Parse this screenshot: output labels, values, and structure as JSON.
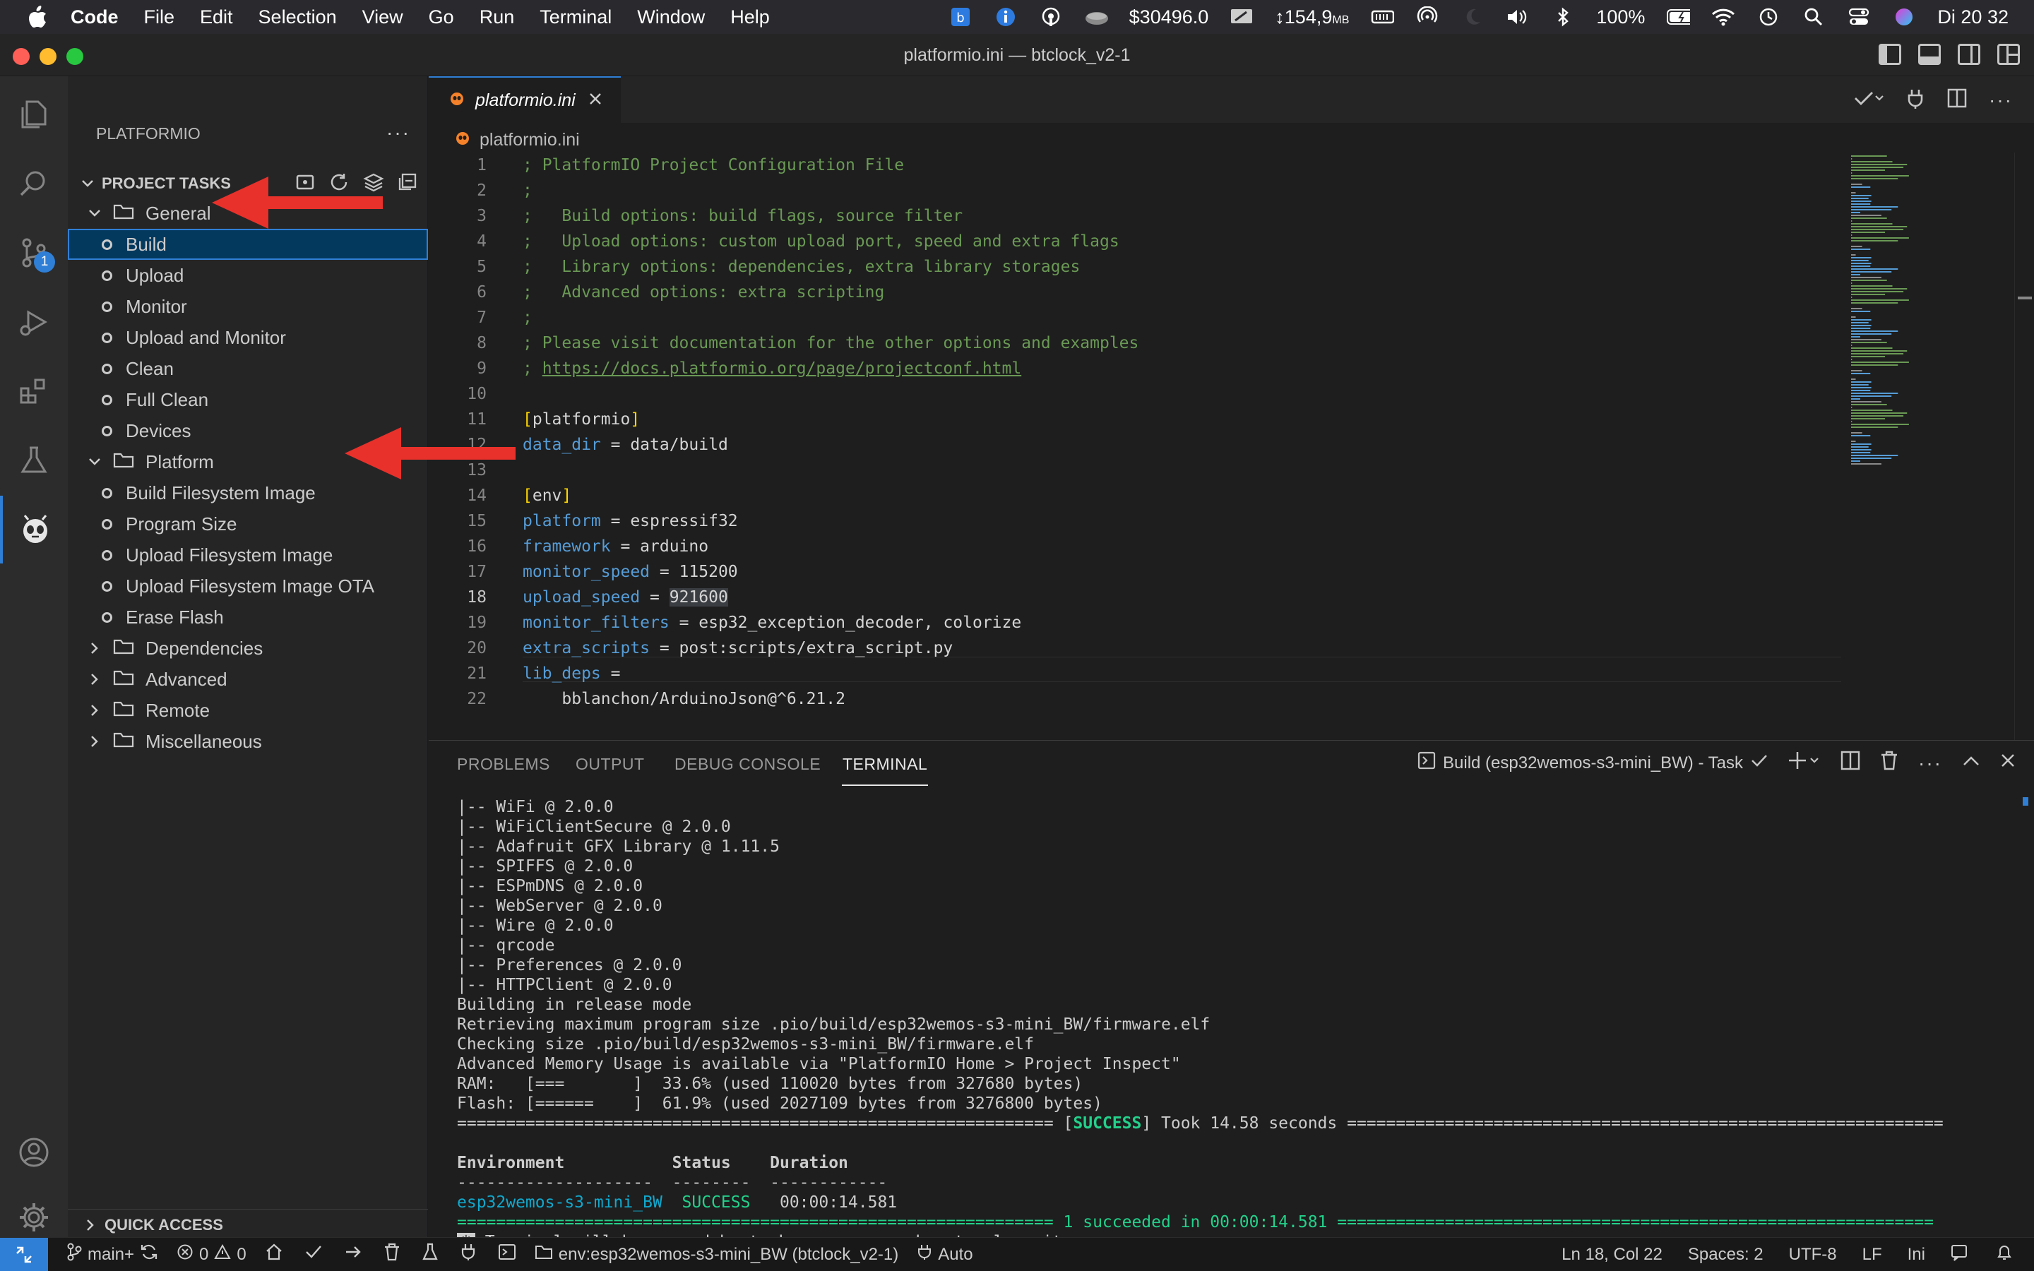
{
  "menubar": {
    "app": "Code",
    "items": [
      "File",
      "Edit",
      "Selection",
      "View",
      "Go",
      "Run",
      "Terminal",
      "Window",
      "Help"
    ],
    "price": "$30496.0",
    "memory": "↕154,9",
    "memory_unit": "MB",
    "battery": "100%",
    "clock": "Di 20 32"
  },
  "window": {
    "title": "platformio.ini — btclock_v2-1"
  },
  "activity": {
    "scm_badge": "1"
  },
  "sidebar": {
    "title": "PLATFORMIO",
    "project_tasks": "PROJECT TASKS",
    "general": "General",
    "general_items": [
      "Build",
      "Upload",
      "Monitor",
      "Upload and Monitor",
      "Clean",
      "Full Clean",
      "Devices"
    ],
    "platform": "Platform",
    "platform_items": [
      "Build Filesystem Image",
      "Program Size",
      "Upload Filesystem Image",
      "Upload Filesystem Image OTA",
      "Erase Flash"
    ],
    "folders": [
      "Dependencies",
      "Advanced",
      "Remote",
      "Miscellaneous"
    ],
    "quick_access": "QUICK ACCESS"
  },
  "editor": {
    "tab": "platformio.ini",
    "breadcrumb": "platformio.ini",
    "current_line": "18",
    "lines": [
      {
        "n": "1",
        "parts": [
          {
            "c": "cmt",
            "t": "; PlatformIO Project Configuration File"
          }
        ]
      },
      {
        "n": "2",
        "parts": [
          {
            "c": "cmt",
            "t": ";"
          }
        ]
      },
      {
        "n": "3",
        "parts": [
          {
            "c": "cmt",
            "t": ";   Build options: build flags, source filter"
          }
        ]
      },
      {
        "n": "4",
        "parts": [
          {
            "c": "cmt",
            "t": ";   Upload options: custom upload port, speed and extra flags"
          }
        ]
      },
      {
        "n": "5",
        "parts": [
          {
            "c": "cmt",
            "t": ";   Library options: dependencies, extra library storages"
          }
        ]
      },
      {
        "n": "6",
        "parts": [
          {
            "c": "cmt",
            "t": ";   Advanced options: extra scripting"
          }
        ]
      },
      {
        "n": "7",
        "parts": [
          {
            "c": "cmt",
            "t": ";"
          }
        ]
      },
      {
        "n": "8",
        "parts": [
          {
            "c": "cmt",
            "t": "; Please visit documentation for the other options and examples"
          }
        ]
      },
      {
        "n": "9",
        "parts": [
          {
            "c": "cmt",
            "t": "; "
          },
          {
            "c": "cmt link",
            "t": "https://docs.platformio.org/page/projectconf.html"
          }
        ]
      },
      {
        "n": "10",
        "parts": []
      },
      {
        "n": "11",
        "parts": [
          {
            "c": "brk",
            "t": "["
          },
          {
            "c": "sect",
            "t": "platformio"
          },
          {
            "c": "brk",
            "t": "]"
          }
        ]
      },
      {
        "n": "12",
        "parts": [
          {
            "c": "key",
            "t": "data_dir"
          },
          {
            "c": "val",
            "t": " = data/build"
          }
        ]
      },
      {
        "n": "13",
        "parts": []
      },
      {
        "n": "14",
        "parts": [
          {
            "c": "brk",
            "t": "["
          },
          {
            "c": "sect",
            "t": "env"
          },
          {
            "c": "brk",
            "t": "]"
          }
        ]
      },
      {
        "n": "15",
        "parts": [
          {
            "c": "key",
            "t": "platform"
          },
          {
            "c": "val",
            "t": " = espressif32"
          }
        ]
      },
      {
        "n": "16",
        "parts": [
          {
            "c": "key",
            "t": "framework"
          },
          {
            "c": "val",
            "t": " = arduino"
          }
        ]
      },
      {
        "n": "17",
        "parts": [
          {
            "c": "key",
            "t": "monitor_speed"
          },
          {
            "c": "val",
            "t": " = 115200"
          }
        ]
      },
      {
        "n": "18",
        "parts": [
          {
            "c": "key",
            "t": "upload_speed"
          },
          {
            "c": "val",
            "t": " = "
          },
          {
            "c": "val hl",
            "t": "921600"
          }
        ]
      },
      {
        "n": "19",
        "parts": [
          {
            "c": "key",
            "t": "monitor_filters"
          },
          {
            "c": "val",
            "t": " = esp32_exception_decoder, colorize"
          }
        ]
      },
      {
        "n": "20",
        "parts": [
          {
            "c": "key",
            "t": "extra_scripts"
          },
          {
            "c": "val",
            "t": " = post:scripts/extra_script.py"
          }
        ]
      },
      {
        "n": "21",
        "parts": [
          {
            "c": "key",
            "t": "lib_deps"
          },
          {
            "c": "val",
            "t": " ="
          }
        ]
      },
      {
        "n": "22",
        "parts": [
          {
            "c": "val",
            "t": "    bblanchon/ArduinoJson@^6.21.2"
          }
        ]
      }
    ]
  },
  "panel": {
    "tabs": [
      "PROBLEMS",
      "OUTPUT",
      "DEBUG CONSOLE",
      "TERMINAL"
    ],
    "task": "Build (esp32wemos-s3-mini_BW) - Task",
    "terminal": [
      {
        "parts": [
          {
            "c": "",
            "t": "|-- WiFi @ 2.0.0"
          }
        ]
      },
      {
        "parts": [
          {
            "c": "",
            "t": "|-- WiFiClientSecure @ 2.0.0"
          }
        ]
      },
      {
        "parts": [
          {
            "c": "",
            "t": "|-- Adafruit GFX Library @ 1.11.5"
          }
        ]
      },
      {
        "parts": [
          {
            "c": "",
            "t": "|-- SPIFFS @ 2.0.0"
          }
        ]
      },
      {
        "parts": [
          {
            "c": "",
            "t": "|-- ESPmDNS @ 2.0.0"
          }
        ]
      },
      {
        "parts": [
          {
            "c": "",
            "t": "|-- WebServer @ 2.0.0"
          }
        ]
      },
      {
        "parts": [
          {
            "c": "",
            "t": "|-- Wire @ 2.0.0"
          }
        ]
      },
      {
        "parts": [
          {
            "c": "",
            "t": "|-- qrcode"
          }
        ]
      },
      {
        "parts": [
          {
            "c": "",
            "t": "|-- Preferences @ 2.0.0"
          }
        ]
      },
      {
        "parts": [
          {
            "c": "",
            "t": "|-- HTTPClient @ 2.0.0"
          }
        ]
      },
      {
        "parts": [
          {
            "c": "",
            "t": "Building in release mode"
          }
        ]
      },
      {
        "parts": [
          {
            "c": "",
            "t": "Retrieving maximum program size .pio/build/esp32wemos-s3-mini_BW/firmware.elf"
          }
        ]
      },
      {
        "parts": [
          {
            "c": "",
            "t": "Checking size .pio/build/esp32wemos-s3-mini_BW/firmware.elf"
          }
        ]
      },
      {
        "parts": [
          {
            "c": "",
            "t": "Advanced Memory Usage is available via \"PlatformIO Home > Project Inspect\""
          }
        ]
      },
      {
        "parts": [
          {
            "c": "",
            "t": "RAM:   [===       ]  33.6% (used 110020 bytes from 327680 bytes)"
          }
        ]
      },
      {
        "parts": [
          {
            "c": "",
            "t": "Flash: [======    ]  61.9% (used 2027109 bytes from 3276800 bytes)"
          }
        ]
      },
      {
        "parts": [
          {
            "c": "",
            "t": "============================================================= ["
          },
          {
            "c": "green bold",
            "t": "SUCCESS"
          },
          {
            "c": "",
            "t": "] Took 14.58 seconds ============================================================="
          }
        ]
      },
      {
        "parts": []
      },
      {
        "parts": [
          {
            "c": "bold",
            "t": "Environment           Status    Duration"
          }
        ]
      },
      {
        "parts": [
          {
            "c": "",
            "t": "--------------------  --------  ------------"
          }
        ]
      },
      {
        "parts": [
          {
            "c": "teal",
            "t": "esp32wemos-s3-mini_BW"
          },
          {
            "c": "",
            "t": "  "
          },
          {
            "c": "green",
            "t": "SUCCESS"
          },
          {
            "c": "",
            "t": "   00:00:14.581"
          }
        ]
      },
      {
        "parts": [
          {
            "c": "gbar",
            "t": "============================================================= 1 succeeded in 00:00:14.581 ============================================================="
          }
        ]
      },
      {
        "parts": [
          {
            "c": "termbox",
            "t": "*"
          },
          {
            "c": "",
            "t": " Terminal will be reused by tasks, press any key to close it."
          }
        ]
      }
    ]
  },
  "statusbar": {
    "branch": "main+",
    "errors": "0",
    "warnings": "0",
    "env": "env:esp32wemos-s3-mini_BW (btclock_v2-1)",
    "auto": "Auto",
    "position": "Ln 18, Col 22",
    "spaces": "Spaces: 2",
    "encoding": "UTF-8",
    "eol": "LF",
    "language": "Ini"
  },
  "colors": {
    "accent": "#2f7fd6",
    "annotation_arrow": "#e8312a",
    "comment": "#6a9955",
    "key": "#569cd6",
    "success": "#23d18b"
  }
}
